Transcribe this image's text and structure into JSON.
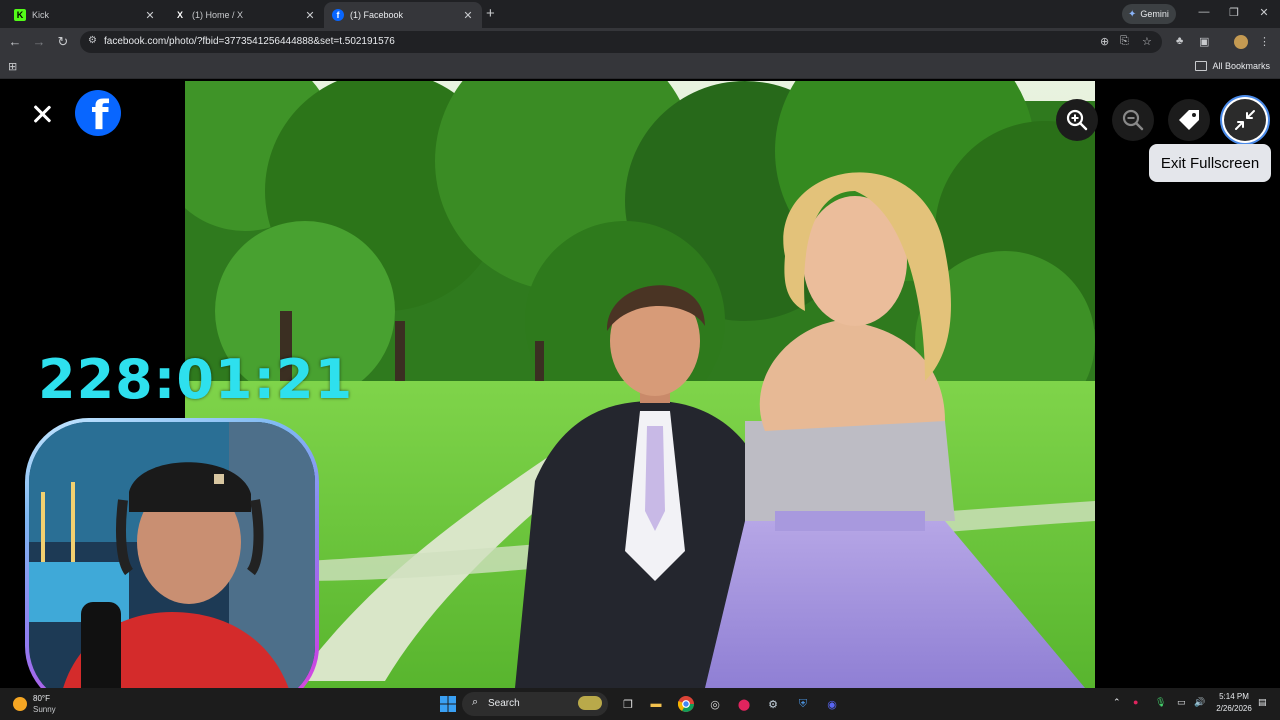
{
  "browser": {
    "tabs": [
      {
        "title": "Kick",
        "icon": "kick-icon",
        "active": false
      },
      {
        "title": "(1) Home / X",
        "icon": "x-icon",
        "active": false
      },
      {
        "title": "(1) Facebook",
        "icon": "facebook-icon",
        "active": true
      }
    ],
    "new_tab_glyph": "+",
    "gemini_label": "Gemini",
    "url": "facebook.com/photo/?fbid=3773541256444888&set=t.502191576",
    "bookmarks": {
      "all_bookmarks_label": "All Bookmarks"
    }
  },
  "viewer": {
    "controls": [
      "zoom-in",
      "zoom-out",
      "tag",
      "exit-fullscreen"
    ],
    "tooltip": "Exit Fullscreen"
  },
  "overlay": {
    "timer": "228:01:21",
    "timer_color": "#2ee0ee"
  },
  "taskbar": {
    "weather": {
      "temp": "80°F",
      "condition": "Sunny"
    },
    "search_label": "Search",
    "time": "5:14 PM",
    "date": "2/26/2026"
  },
  "colors": {
    "facebook_blue": "#0866ff",
    "tooltip_bg": "#e4e6eb",
    "chrome_dark": "#202124"
  }
}
